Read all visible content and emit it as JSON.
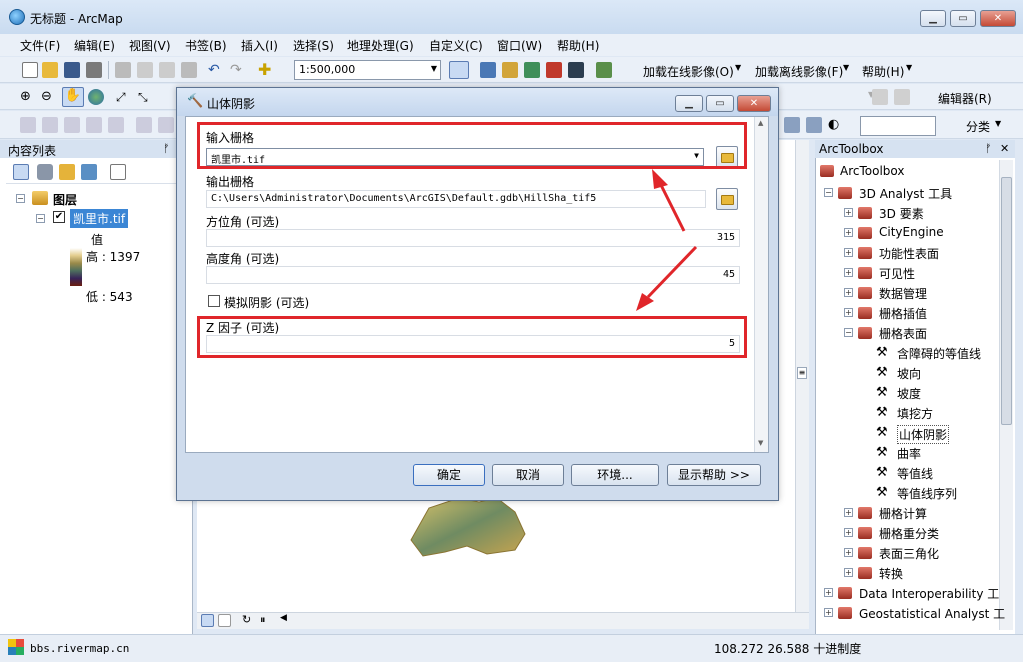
{
  "window": {
    "title": "无标题 - ArcMap"
  },
  "menus": [
    "文件(F)",
    "编辑(E)",
    "视图(V)",
    "书签(B)",
    "插入(I)",
    "选择(S)",
    "地理处理(G)",
    "自定义(C)",
    "窗口(W)",
    "帮助(H)"
  ],
  "toolbar": {
    "scale": "1:500,000",
    "online_imagery": "加载在线影像(O)",
    "offline_imagery": "加载离线影像(F)",
    "help_menu": "帮助(H)",
    "editor_menu": "编辑器(R)",
    "classify_menu": "分类"
  },
  "toc": {
    "title": "内容列表",
    "layers_group": "图层",
    "layer_name": "凯里市.tif",
    "value_label": "值",
    "high_label": "高 : 1397",
    "low_label": "低 : 543"
  },
  "toolbox": {
    "title": "ArcToolbox",
    "root": "ArcToolbox",
    "items": [
      {
        "label": "3D Analyst 工具",
        "level": 1,
        "expanded": true,
        "kind": "toolbox"
      },
      {
        "label": "3D 要素",
        "level": 2,
        "expanded": false,
        "kind": "toolbox"
      },
      {
        "label": "CityEngine",
        "level": 2,
        "expanded": false,
        "kind": "toolbox"
      },
      {
        "label": "功能性表面",
        "level": 2,
        "expanded": false,
        "kind": "toolbox"
      },
      {
        "label": "可见性",
        "level": 2,
        "expanded": false,
        "kind": "toolbox"
      },
      {
        "label": "数据管理",
        "level": 2,
        "expanded": false,
        "kind": "toolbox"
      },
      {
        "label": "栅格插值",
        "level": 2,
        "expanded": false,
        "kind": "toolbox"
      },
      {
        "label": "栅格表面",
        "level": 2,
        "expanded": true,
        "kind": "toolbox"
      },
      {
        "label": "含障碍的等值线",
        "level": 3,
        "kind": "tool"
      },
      {
        "label": "坡向",
        "level": 3,
        "kind": "tool"
      },
      {
        "label": "坡度",
        "level": 3,
        "kind": "tool"
      },
      {
        "label": "填挖方",
        "level": 3,
        "kind": "tool"
      },
      {
        "label": "山体阴影",
        "level": 3,
        "kind": "tool",
        "selected": true
      },
      {
        "label": "曲率",
        "level": 3,
        "kind": "tool"
      },
      {
        "label": "等值线",
        "level": 3,
        "kind": "tool"
      },
      {
        "label": "等值线序列",
        "level": 3,
        "kind": "tool"
      },
      {
        "label": "栅格计算",
        "level": 2,
        "expanded": false,
        "kind": "toolbox"
      },
      {
        "label": "栅格重分类",
        "level": 2,
        "expanded": false,
        "kind": "toolbox"
      },
      {
        "label": "表面三角化",
        "level": 2,
        "expanded": false,
        "kind": "toolbox"
      },
      {
        "label": "转换",
        "level": 2,
        "expanded": false,
        "kind": "toolbox"
      },
      {
        "label": "Data Interoperability 工",
        "level": 1,
        "expanded": false,
        "kind": "toolbox"
      },
      {
        "label": "Geostatistical Analyst 工",
        "level": 1,
        "expanded": false,
        "kind": "toolbox"
      }
    ]
  },
  "dialog": {
    "title": "山体阴影",
    "input_raster_label": "输入栅格",
    "input_raster_value": "凯里市.tif",
    "output_raster_label": "输出栅格",
    "output_raster_value": "C:\\Users\\Administrator\\Documents\\ArcGIS\\Default.gdb\\HillSha_tif5",
    "azimuth_label": "方位角 (可选)",
    "azimuth_value": "315",
    "altitude_label": "高度角 (可选)",
    "altitude_value": "45",
    "model_shadows_label": "模拟阴影 (可选)",
    "z_factor_label": "Z 因子 (可选)",
    "z_factor_value": "5",
    "ok": "确定",
    "cancel": "取消",
    "env": "环境...",
    "show_help": "显示帮助 >>"
  },
  "status": {
    "watermark": "bbs.rivermap.cn",
    "coords": "108.272  26.588 十进制度"
  }
}
